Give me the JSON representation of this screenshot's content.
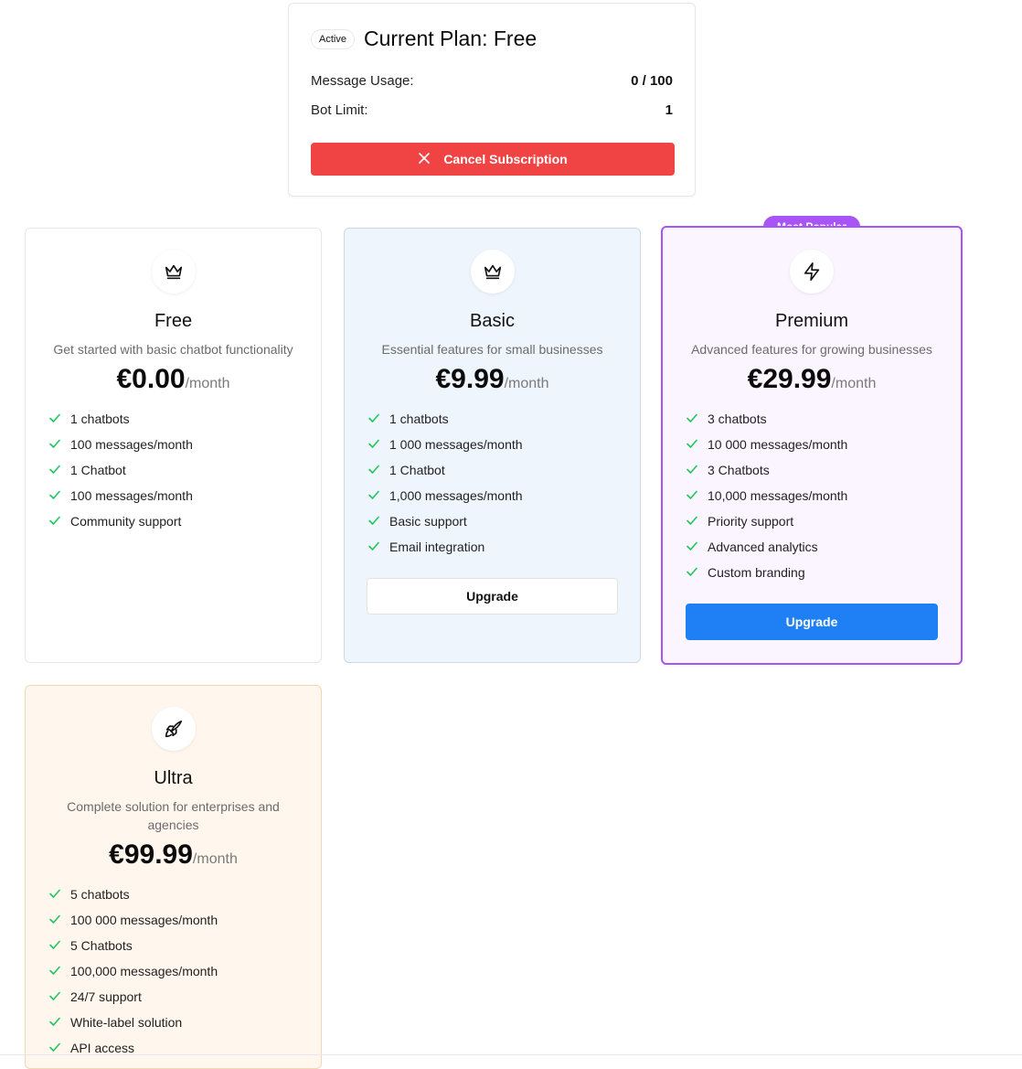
{
  "current_plan": {
    "badge": "Active",
    "title": "Current Plan: Free",
    "message_usage_label": "Message Usage:",
    "message_usage_value": "0 / 100",
    "bot_limit_label": "Bot Limit:",
    "bot_limit_value": "1",
    "cancel_label": "Cancel Subscription"
  },
  "popular_badge": "Most Popular",
  "plans": [
    {
      "name": "Free",
      "icon": "crown-icon",
      "description": "Get started with basic chatbot functionality",
      "price": "€0.00",
      "period": "/month",
      "features": [
        "1 chatbots",
        "100 messages/month",
        "1 Chatbot",
        "100 messages/month",
        "Community support"
      ]
    },
    {
      "name": "Basic",
      "icon": "crown-icon",
      "description": "Essential features for small businesses",
      "price": "€9.99",
      "period": "/month",
      "features": [
        "1 chatbots",
        "1 000 messages/month",
        "1 Chatbot",
        "1,000 messages/month",
        "Basic support",
        "Email integration"
      ],
      "button": "Upgrade"
    },
    {
      "name": "Premium",
      "icon": "zap-icon",
      "description": "Advanced features for growing businesses",
      "price": "€29.99",
      "period": "/month",
      "features": [
        "3 chatbots",
        "10 000 messages/month",
        "3 Chatbots",
        "10,000 messages/month",
        "Priority support",
        "Advanced analytics",
        "Custom branding"
      ],
      "button": "Upgrade"
    },
    {
      "name": "Ultra",
      "icon": "rocket-icon",
      "description": "Complete solution for enterprises and agencies",
      "price": "€99.99",
      "period": "/month",
      "features": [
        "5 chatbots",
        "100 000 messages/month",
        "5 Chatbots",
        "100,000 messages/month",
        "24/7 support",
        "White-label solution",
        "API access"
      ]
    }
  ],
  "colors": {
    "cancel": "#f04343",
    "premium_border": "#a855f7",
    "upgrade_primary": "#1f80f5",
    "check": "#22c55e"
  }
}
